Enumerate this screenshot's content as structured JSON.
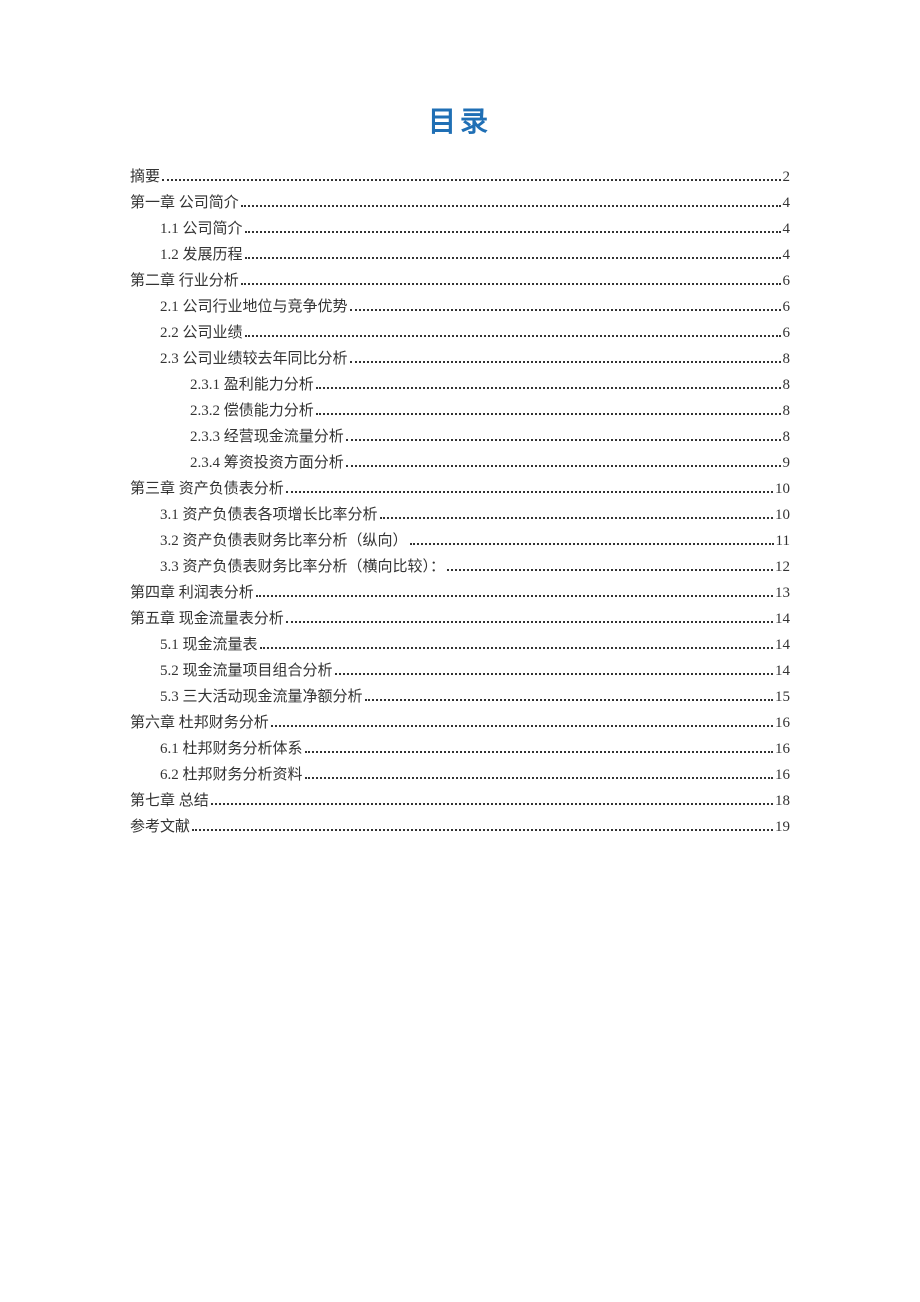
{
  "title": "目录",
  "entries": [
    {
      "label": "摘要",
      "page": "2",
      "level": 0
    },
    {
      "label": "第一章  公司简介",
      "page": "4",
      "level": 0
    },
    {
      "label": "1.1  公司简介",
      "page": "4",
      "level": 1
    },
    {
      "label": "1.2  发展历程",
      "page": "4",
      "level": 1
    },
    {
      "label": "第二章  行业分析",
      "page": "6",
      "level": 0
    },
    {
      "label": "2.1  公司行业地位与竞争优势",
      "page": "6",
      "level": 1
    },
    {
      "label": "2.2  公司业绩",
      "page": "6",
      "level": 1
    },
    {
      "label": "2.3 公司业绩较去年同比分析",
      "page": "8",
      "level": 1
    },
    {
      "label": "2.3.1  盈利能力分析",
      "page": "8",
      "level": 2
    },
    {
      "label": "2.3.2  偿债能力分析",
      "page": "8",
      "level": 2
    },
    {
      "label": "2.3.3  经营现金流量分析",
      "page": "8",
      "level": 2
    },
    {
      "label": "2.3.4  筹资投资方面分析",
      "page": "9",
      "level": 2
    },
    {
      "label": "第三章  资产负债表分析",
      "page": "10",
      "level": 0
    },
    {
      "label": "3.1 资产负债表各项增长比率分析",
      "page": "10",
      "level": 1
    },
    {
      "label": "3.2 资产负债表财务比率分析（纵向）",
      "page": "11",
      "level": 1
    },
    {
      "label": "3.3 资产负债表财务比率分析（横向比较）：",
      "page": "12",
      "level": 1
    },
    {
      "label": "第四章 利润表分析",
      "page": "13",
      "level": 0
    },
    {
      "label": "第五章 现金流量表分析",
      "page": "14",
      "level": 0
    },
    {
      "label": "5.1 现金流量表",
      "page": "14",
      "level": 1
    },
    {
      "label": "5.2 现金流量项目组合分析",
      "page": "14",
      "level": 1
    },
    {
      "label": "5.3 三大活动现金流量净额分析",
      "page": "15",
      "level": 1
    },
    {
      "label": "第六章 杜邦财务分析",
      "page": "16",
      "level": 0
    },
    {
      "label": "6.1 杜邦财务分析体系",
      "page": "16",
      "level": 1
    },
    {
      "label": "6.2 杜邦财务分析资料",
      "page": "16",
      "level": 1
    },
    {
      "label": "第七章 总结",
      "page": "18",
      "level": 0
    },
    {
      "label": "参考文献",
      "page": "19",
      "level": 0
    }
  ]
}
